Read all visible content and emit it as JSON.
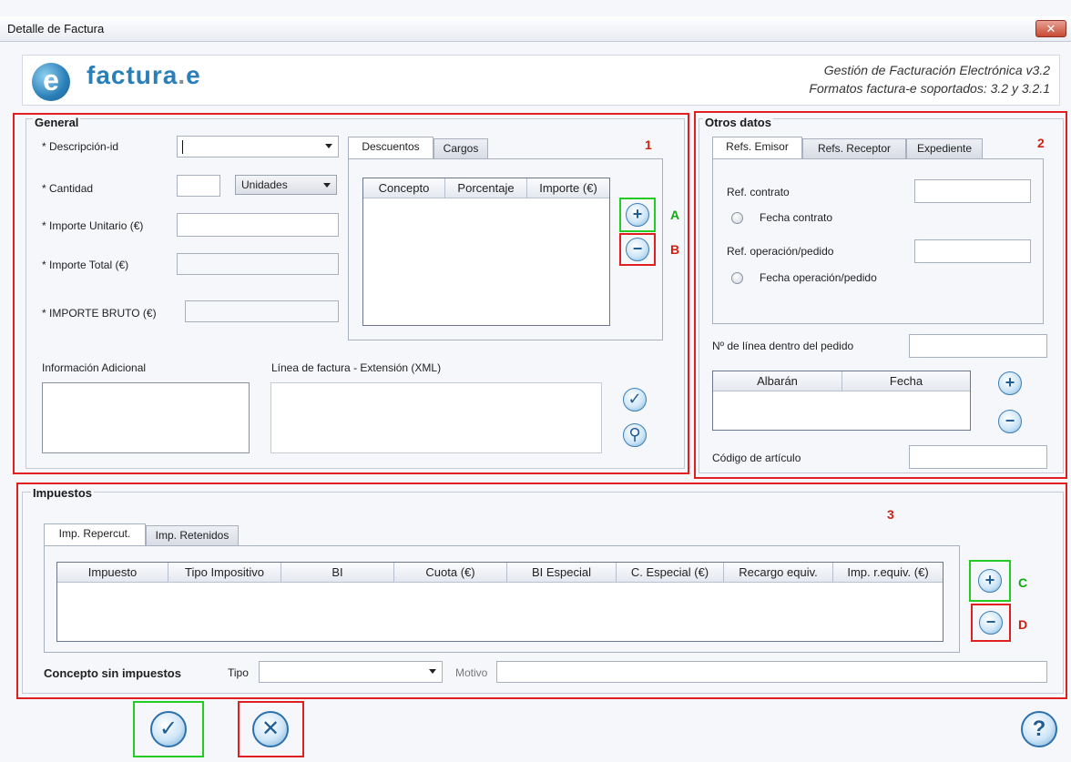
{
  "window": {
    "title": "Detalle de Factura",
    "close_glyph": "✕"
  },
  "header": {
    "logo_e": "e",
    "logo_brand": "factura",
    "logo_dot": ".",
    "logo_suffix": "e",
    "line1": "Gestión de Facturación Electrónica v3.2",
    "line2": "Formatos factura-e soportados: 3.2 y 3.2.1"
  },
  "general": {
    "title": "General",
    "marker": "1",
    "fields": {
      "descripcion": "* Descripción-id",
      "cantidad": "* Cantidad",
      "unidades": "Unidades",
      "importe_unitario": "* Importe Unitario (€)",
      "importe_total": "* Importe Total (€)",
      "importe_bruto": "* IMPORTE BRUTO (€)"
    },
    "tabs": [
      "Descuentos",
      "Cargos"
    ],
    "table_headers": [
      "Concepto",
      "Porcentaje",
      "Importe (€)"
    ],
    "add_marker": "A",
    "remove_marker": "B",
    "info_adicional": "Información Adicional",
    "linea_extension": "Línea de factura - Extensión (XML)"
  },
  "otros": {
    "title": "Otros datos",
    "marker": "2",
    "tabs": [
      "Refs. Emisor",
      "Refs. Receptor",
      "Expediente"
    ],
    "ref_contrato": "Ref. contrato",
    "fecha_contrato": "Fecha contrato",
    "ref_operacion": "Ref. operación/pedido",
    "fecha_operacion": "Fecha operación/pedido",
    "num_linea": "Nº de línea dentro del pedido",
    "table_headers": [
      "Albarán",
      "Fecha"
    ],
    "codigo_articulo": "Código de artículo"
  },
  "impuestos": {
    "title": "Impuestos",
    "marker": "3",
    "tabs": [
      "Imp. Repercut.",
      "Imp. Retenidos"
    ],
    "table_headers": [
      "Impuesto",
      "Tipo Impositivo",
      "BI",
      "Cuota (€)",
      "BI Especial",
      "C. Especial (€)",
      "Recargo equiv.",
      "Imp. r.equiv. (€)"
    ],
    "add_marker": "C",
    "remove_marker": "D",
    "concepto_sin": "Concepto sin impuestos",
    "tipo": "Tipo",
    "motivo": "Motivo"
  },
  "icons": {
    "add": "+",
    "remove": "−",
    "check": "✓",
    "search": "⚲",
    "cancel": "✕",
    "help": "?"
  },
  "colors": {
    "marker_red": "#e02020",
    "marker_green": "#22cc22",
    "accent_blue": "#2a7fb8"
  }
}
